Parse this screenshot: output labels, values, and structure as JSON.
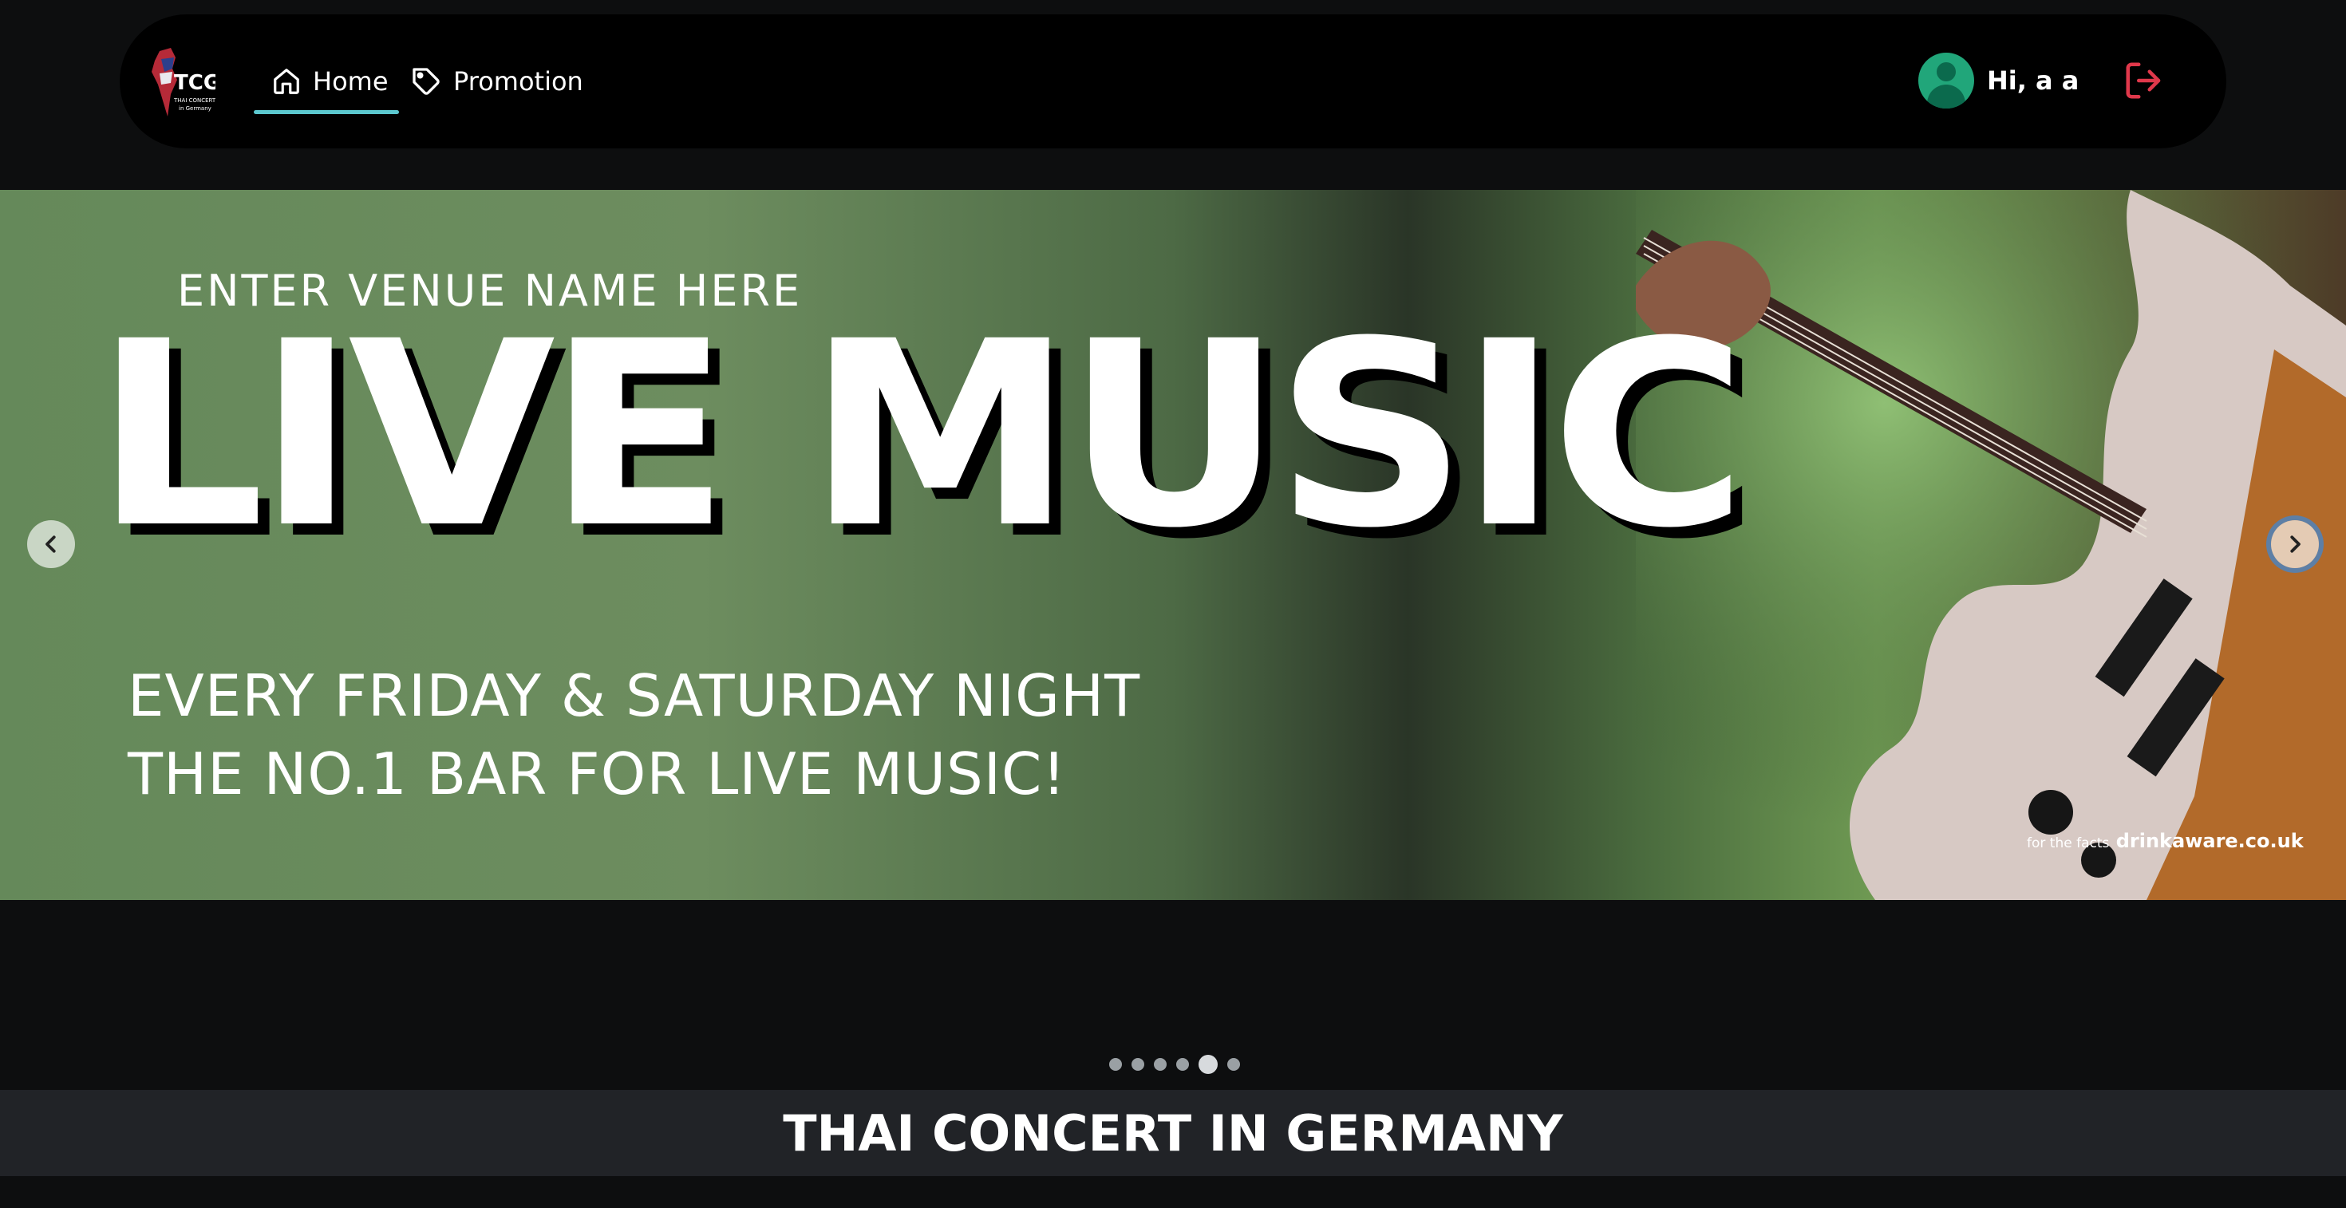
{
  "header": {
    "logo_text": "TCG",
    "nav": [
      {
        "label": "Home",
        "active": true
      },
      {
        "label": "Promotion",
        "active": false
      }
    ],
    "user": {
      "greeting": "Hi, a a"
    },
    "accent_color": "#5cc8cf",
    "logout_color": "#e0384b"
  },
  "banner": {
    "venue": "ENTER VENUE NAME HERE",
    "headline": "LIVE MUSIC",
    "line1": "EVERY FRIDAY & SATURDAY NIGHT",
    "line2": "THE NO.1 BAR FOR LIVE MUSIC!",
    "credit_prefix": "for the facts",
    "credit_site": "drinkaware.co.uk"
  },
  "carousel": {
    "slide_count": 6,
    "active_index": 4
  },
  "footer": {
    "title": "THAI CONCERT IN GERMANY"
  }
}
